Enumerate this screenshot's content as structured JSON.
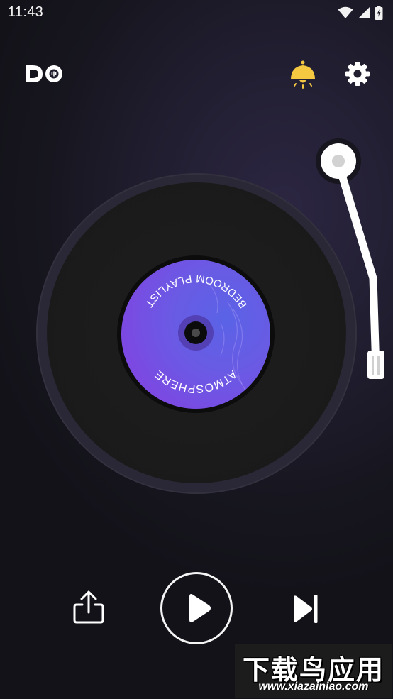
{
  "status_bar": {
    "time": "11:43"
  },
  "header": {
    "logo_text": "DO",
    "lamp_icon": "lamp-icon",
    "settings_icon": "gear-icon"
  },
  "record": {
    "label_top_text": "BEDROOM PLAYLIST",
    "label_bottom_text": "ATMOSPHERE",
    "label_color": "#6a5ae4"
  },
  "controls": {
    "share_icon": "share-icon",
    "play_icon": "play-icon",
    "next_icon": "skip-next-icon"
  },
  "watermark": {
    "chinese_text": "下载鸟应用",
    "url_text": "www.xiazainiao.com"
  },
  "colors": {
    "lamp": "#f5c842",
    "accent": "#ffffff"
  }
}
